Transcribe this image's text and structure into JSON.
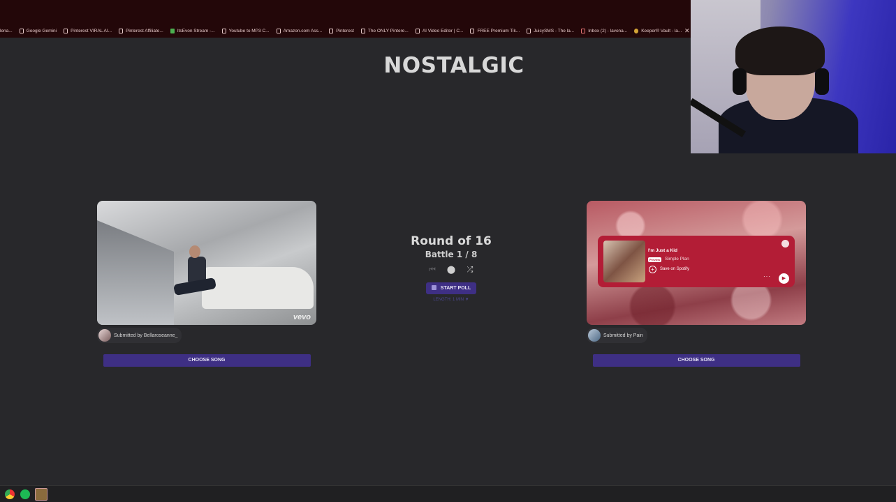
{
  "bookmarks": [
    {
      "label": "lena...",
      "icon": "page-icon"
    },
    {
      "label": "Google Gemini",
      "icon": "page-icon"
    },
    {
      "label": "Pinterest VIRAL AI...",
      "icon": "page-icon"
    },
    {
      "label": "Pinterest Affiliate...",
      "icon": "page-icon"
    },
    {
      "label": "ItsEvon Stream -...",
      "icon": "kick-icon"
    },
    {
      "label": "Youtube to MP3 C...",
      "icon": "page-icon"
    },
    {
      "label": "Amazon.com Ass...",
      "icon": "page-icon"
    },
    {
      "label": "Pinterest",
      "icon": "page-icon"
    },
    {
      "label": "The ONLY Pintere...",
      "icon": "page-icon"
    },
    {
      "label": "AI Video Editor | C...",
      "icon": "page-icon"
    },
    {
      "label": "FREE Premium Tik...",
      "icon": "page-icon"
    },
    {
      "label": "JuicySMS - The la...",
      "icon": "page-icon"
    },
    {
      "label": "Inbox (2) - lavona...",
      "icon": "gmail-icon"
    },
    {
      "label": "Keeper® Vault - la...",
      "icon": "keeper-icon"
    }
  ],
  "page": {
    "title": "NOSTALGIC",
    "round": "Round of 16",
    "battle": "Battle 1 / 8",
    "start_poll": "START POLL",
    "length": "LENGTH: 1 MIN ▼"
  },
  "left_card": {
    "watermark": "vevo",
    "submitted": "Submitted by Bellaroseanne_",
    "choose": "CHOOSE SONG"
  },
  "right_card": {
    "song_title": "I'm Just a Kid",
    "preview_badge": "Preview",
    "artist": "Simple Plan",
    "save_label": "Save on Spotify",
    "more": "···",
    "submitted": "Submitted by Pain",
    "choose": "CHOOSE SONG"
  },
  "colors": {
    "accent": "#3e2f84",
    "spotify_embed": "#b31d36",
    "background": "#28282b",
    "bookmarks_bar": "#230709"
  }
}
